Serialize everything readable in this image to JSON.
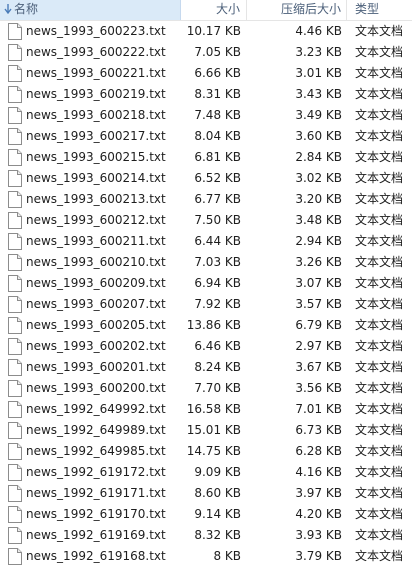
{
  "header": {
    "name_label": "名称",
    "size_label": "大小",
    "compressed_label": "压缩后大小",
    "type_label": "类型"
  },
  "files": [
    {
      "name": "news_1993_600223.txt",
      "size": "10.17 KB",
      "compressed": "4.46 KB",
      "type": "文本文档"
    },
    {
      "name": "news_1993_600222.txt",
      "size": "7.05 KB",
      "compressed": "3.23 KB",
      "type": "文本文档"
    },
    {
      "name": "news_1993_600221.txt",
      "size": "6.66 KB",
      "compressed": "3.01 KB",
      "type": "文本文档"
    },
    {
      "name": "news_1993_600219.txt",
      "size": "8.31 KB",
      "compressed": "3.43 KB",
      "type": "文本文档"
    },
    {
      "name": "news_1993_600218.txt",
      "size": "7.48 KB",
      "compressed": "3.49 KB",
      "type": "文本文档"
    },
    {
      "name": "news_1993_600217.txt",
      "size": "8.04 KB",
      "compressed": "3.60 KB",
      "type": "文本文档"
    },
    {
      "name": "news_1993_600215.txt",
      "size": "6.81 KB",
      "compressed": "2.84 KB",
      "type": "文本文档"
    },
    {
      "name": "news_1993_600214.txt",
      "size": "6.52 KB",
      "compressed": "3.02 KB",
      "type": "文本文档"
    },
    {
      "name": "news_1993_600213.txt",
      "size": "6.77 KB",
      "compressed": "3.20 KB",
      "type": "文本文档"
    },
    {
      "name": "news_1993_600212.txt",
      "size": "7.50 KB",
      "compressed": "3.48 KB",
      "type": "文本文档"
    },
    {
      "name": "news_1993_600211.txt",
      "size": "6.44 KB",
      "compressed": "2.94 KB",
      "type": "文本文档"
    },
    {
      "name": "news_1993_600210.txt",
      "size": "7.03 KB",
      "compressed": "3.26 KB",
      "type": "文本文档"
    },
    {
      "name": "news_1993_600209.txt",
      "size": "6.94 KB",
      "compressed": "3.07 KB",
      "type": "文本文档"
    },
    {
      "name": "news_1993_600207.txt",
      "size": "7.92 KB",
      "compressed": "3.57 KB",
      "type": "文本文档"
    },
    {
      "name": "news_1993_600205.txt",
      "size": "13.86 KB",
      "compressed": "6.79 KB",
      "type": "文本文档"
    },
    {
      "name": "news_1993_600202.txt",
      "size": "6.46 KB",
      "compressed": "2.97 KB",
      "type": "文本文档"
    },
    {
      "name": "news_1993_600201.txt",
      "size": "8.24 KB",
      "compressed": "3.67 KB",
      "type": "文本文档"
    },
    {
      "name": "news_1993_600200.txt",
      "size": "7.70 KB",
      "compressed": "3.56 KB",
      "type": "文本文档"
    },
    {
      "name": "news_1992_649992.txt",
      "size": "16.58 KB",
      "compressed": "7.01 KB",
      "type": "文本文档"
    },
    {
      "name": "news_1992_649989.txt",
      "size": "15.01 KB",
      "compressed": "6.73 KB",
      "type": "文本文档"
    },
    {
      "name": "news_1992_649985.txt",
      "size": "14.75 KB",
      "compressed": "6.28 KB",
      "type": "文本文档"
    },
    {
      "name": "news_1992_619172.txt",
      "size": "9.09 KB",
      "compressed": "4.16 KB",
      "type": "文本文档"
    },
    {
      "name": "news_1992_619171.txt",
      "size": "8.60 KB",
      "compressed": "3.97 KB",
      "type": "文本文档"
    },
    {
      "name": "news_1992_619170.txt",
      "size": "9.14 KB",
      "compressed": "4.20 KB",
      "type": "文本文档"
    },
    {
      "name": "news_1992_619169.txt",
      "size": "8.32 KB",
      "compressed": "3.93 KB",
      "type": "文本文档"
    },
    {
      "name": "news_1992_619168.txt",
      "size": "8 KB",
      "compressed": "3.79 KB",
      "type": "文本文档"
    }
  ]
}
